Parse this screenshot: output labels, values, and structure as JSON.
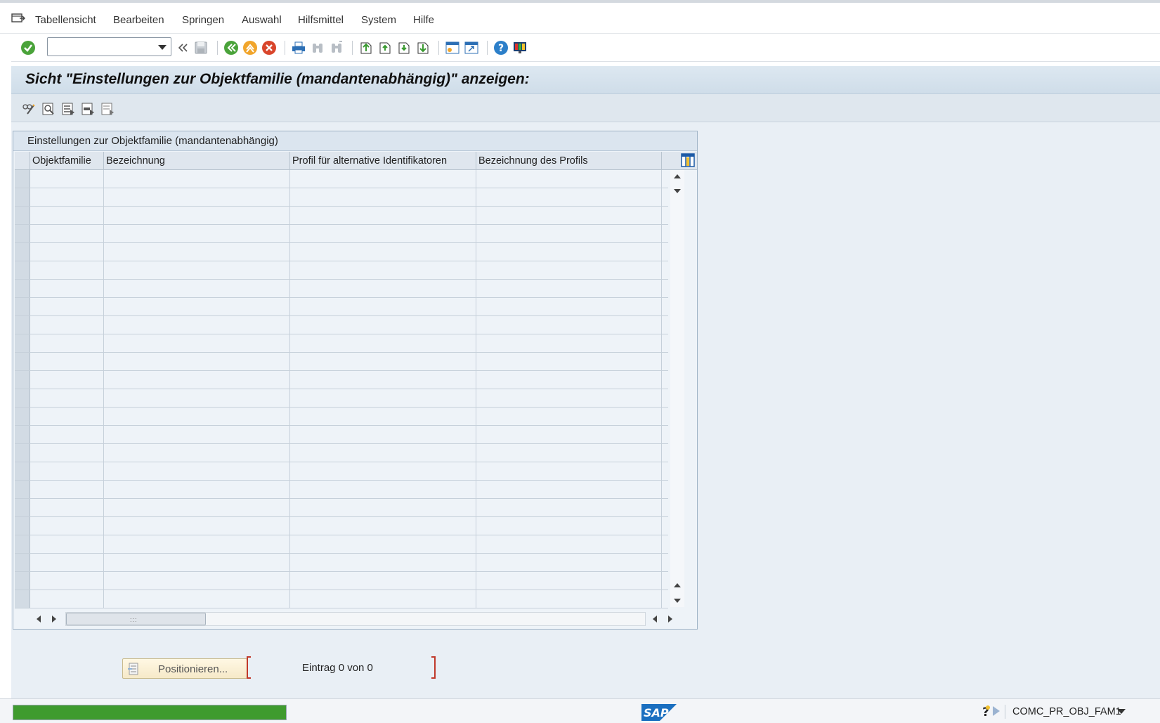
{
  "menu": {
    "items": [
      {
        "label": "Tabellensicht"
      },
      {
        "label": "Bearbeiten"
      },
      {
        "label": "Springen"
      },
      {
        "label": "Auswahl"
      },
      {
        "label": "Hilfsmittel"
      },
      {
        "label": "System"
      },
      {
        "label": "Hilfe"
      }
    ]
  },
  "toolbar": {
    "command_value": "",
    "icons": [
      "check-icon",
      "back-double-icon",
      "save-icon",
      "back-icon",
      "exit-icon",
      "cancel-icon",
      "print-icon",
      "find-icon",
      "find-next-icon",
      "first-page-icon",
      "previous-page-icon",
      "next-page-icon",
      "last-page-icon",
      "create-session-icon",
      "generate-shortcut-icon",
      "help-icon",
      "customize-layout-icon"
    ]
  },
  "page": {
    "title": "Sicht \"Einstellungen zur Objektfamilie (mandantenabhängig)\" anzeigen:"
  },
  "app_toolbar": {
    "icons": [
      "display-change-icon",
      "details-icon",
      "select-all-icon",
      "select-block-icon",
      "deselect-all-icon"
    ]
  },
  "table": {
    "title": "Einstellungen zur Objektfamilie (mandantenabhängig)",
    "columns": [
      {
        "label": "Objektfamilie"
      },
      {
        "label": "Bezeichnung"
      },
      {
        "label": "Profil für alternative Identifikatoren"
      },
      {
        "label": "Bezeichnung des Profils"
      }
    ],
    "row_count": 24,
    "rows": []
  },
  "footer": {
    "position_button": "Positionieren...",
    "entry_text": "Eintrag 0 von 0"
  },
  "statusbar": {
    "progress": 1.0,
    "progress_color": "#3f9b2e",
    "logo_text": "SAP",
    "transaction": "COMC_PR_OBJ_FAM1"
  },
  "colors": {
    "title_bar": "#cfdde9",
    "background": "#e9eff5",
    "sap_blue": "#1a6fc0"
  }
}
